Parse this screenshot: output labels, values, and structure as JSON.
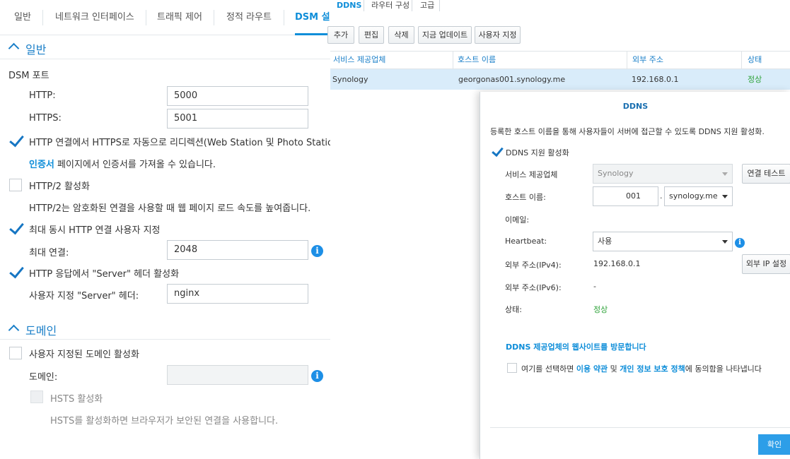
{
  "left": {
    "tabs": [
      "일반",
      "네트워크 인터페이스",
      "트래픽 제어",
      "정적 라우트",
      "DSM 설정"
    ],
    "general_section": {
      "title": "일반",
      "dsm_port_label": "DSM 포트",
      "http_label": "HTTP:",
      "http_value": "5000",
      "https_label": "HTTPS:",
      "https_value": "5001",
      "redirect_label": "HTTP 연결에서 HTTPS로 자동으로 리디렉션(Web Station 및 Photo Station",
      "cert_link": "인증서",
      "cert_text": " 페이지에서 인증서를 가져올 수 있습니다.",
      "http2_label": "HTTP/2 활성화",
      "http2_desc": "HTTP/2는 암호화된 연결을 사용할 때 웹 페이지 로드 속도를 높여줍니다.",
      "max_conn_check_label": "최대 동시 HTTP 연결 사용자 지정",
      "max_conn_label": "최대 연결:",
      "max_conn_value": "2048",
      "server_header_check_label": "HTTP 응답에서 \"Server\" 헤더 활성화",
      "server_header_label": "사용자 지정 \"Server\" 헤더:",
      "server_header_value": "nginx"
    },
    "domain_section": {
      "title": "도메인",
      "custom_domain_label": "사용자 지정된 도메인 활성화",
      "domain_label": "도메인:",
      "domain_value": "",
      "hsts_label": "HSTS 활성화",
      "hsts_desc": "HSTS를 활성화하면 브라우저가 보안된 연결을 사용합니다."
    }
  },
  "right": {
    "tabs": [
      "DDNS",
      "라우터 구성",
      "고급"
    ],
    "toolbar": [
      "추가",
      "편집",
      "삭제",
      "지금 업데이트",
      "사용자 지정"
    ],
    "columns": [
      "서비스 제공업체",
      "호스트 이름",
      "외부 주소",
      "상태"
    ],
    "row": {
      "provider": "Synology",
      "hostname": "georgonas001.synology.me",
      "address": "192.168.0.1",
      "status": "정상"
    }
  },
  "dialog": {
    "title": "DDNS",
    "description": "등록한 호스트 이름을 통해 사용자들이 서버에 접근할 수 있도록 DDNS 지원 활성화.",
    "enable_label": "DDNS 지원 활성화",
    "provider_label": "서비스 제공업체",
    "provider_value": "Synology",
    "test_button": "연결 테스트",
    "hostname_label": "호스트 이름:",
    "hostname_value": "001",
    "hostname_dot": ".",
    "domain_value": "synology.me",
    "email_label": "이메일:",
    "heartbeat_label": "Heartbeat:",
    "heartbeat_value": "사용",
    "ipv4_label": "외부 주소(IPv4):",
    "ipv4_value": "192.168.0.1",
    "external_ip_button": "외부 IP 설정",
    "ipv6_label": "외부 주소(IPv6):",
    "ipv6_value": "-",
    "status_label": "상태:",
    "status_value": "정상",
    "visit_link": "DDNS 제공업체의 웹사이트를 방문합니다",
    "terms_prefix": "여기를 선택하면 ",
    "terms_link": "이용 약관",
    "terms_and": " 및 ",
    "privacy_link": "개인 정보 보호 정책",
    "terms_suffix": "에 동의함을 나타냅니다",
    "ok_button": "확인"
  }
}
